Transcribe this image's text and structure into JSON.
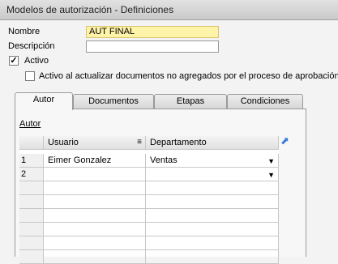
{
  "window": {
    "title": "Modelos de autorización - Definiciones"
  },
  "form": {
    "nombre_label": "Nombre",
    "nombre_value": "AUT FINAL",
    "descripcion_label": "Descripción",
    "descripcion_value": "",
    "activo_label": "Activo",
    "activo_checked": true,
    "activo_docs_label": "Activo al actualizar documentos no agregados por el proceso de aprobación",
    "activo_docs_checked": false
  },
  "tabs": [
    {
      "label": "Autor",
      "active": true
    },
    {
      "label": "Documentos",
      "active": false
    },
    {
      "label": "Etapas",
      "active": false
    },
    {
      "label": "Condiciones",
      "active": false
    }
  ],
  "autor": {
    "section_label": "Autor",
    "columns": [
      "",
      "Usuario",
      "Departamento"
    ],
    "rows": [
      {
        "num": "1",
        "usuario": "Eimer Gonzalez",
        "departamento": "Ventas"
      },
      {
        "num": "2",
        "usuario": "",
        "departamento": ""
      },
      {
        "num": "",
        "usuario": "",
        "departamento": ""
      },
      {
        "num": "",
        "usuario": "",
        "departamento": ""
      },
      {
        "num": "",
        "usuario": "",
        "departamento": ""
      },
      {
        "num": "",
        "usuario": "",
        "departamento": ""
      },
      {
        "num": "",
        "usuario": "",
        "departamento": ""
      },
      {
        "num": "",
        "usuario": "",
        "departamento": ""
      }
    ]
  },
  "icons": {
    "checkmark": "checkmark-icon",
    "dropdown": "dropdown-arrow-icon",
    "expand": "expand-arrow-icon",
    "column_options": "column-options-icon"
  }
}
